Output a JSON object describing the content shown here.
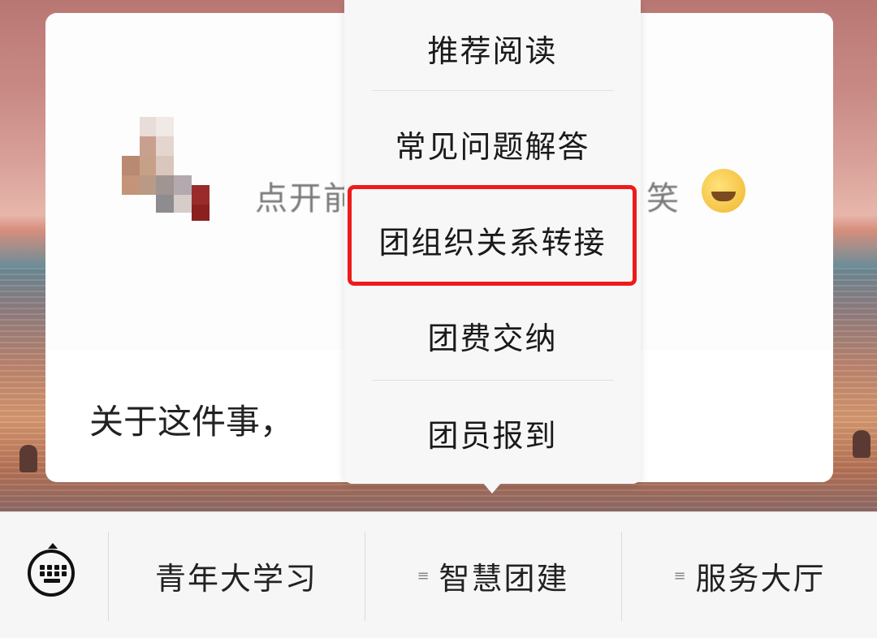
{
  "article": {
    "cover_text_left": "点开前",
    "cover_text_right": "笑",
    "cover_emoji_icon": "laughing-face-emoji",
    "title": "关于这件事，"
  },
  "popup_menu": {
    "items": [
      {
        "label": "推荐阅读"
      },
      {
        "label": "常见问题解答"
      },
      {
        "label": "团组织关系转接",
        "highlighted": true
      },
      {
        "label": "团费交纳"
      },
      {
        "label": "团员报到"
      }
    ],
    "highlight_color": "#ee1b1b"
  },
  "bottom_bar": {
    "keyboard_icon": "keyboard-icon",
    "tabs": [
      {
        "label": "青年大学习",
        "has_submenu": false
      },
      {
        "label": "智慧团建",
        "has_submenu": true
      },
      {
        "label": "服务大厅",
        "has_submenu": true
      }
    ],
    "submenu_glyph": "≡"
  }
}
